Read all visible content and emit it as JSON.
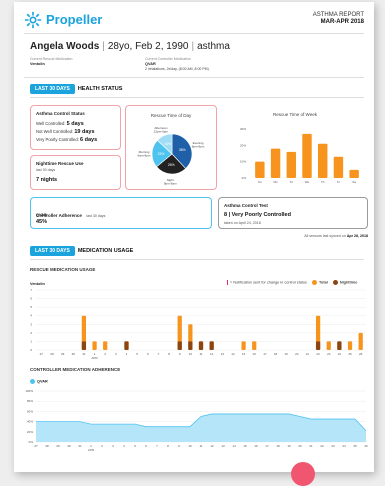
{
  "brand": {
    "name": "Propeller",
    "report_title": "ASTHMA REPORT",
    "report_period": "MAR-APR 2018"
  },
  "patient": {
    "name": "Angela  Woods",
    "age_dob": "28yo, Feb 2, 1990",
    "condition": "asthma"
  },
  "meds": {
    "rescue_label": "Current Rescue Medication",
    "rescue_value": "Ventolin",
    "controller_label": "Current Controller Medication",
    "controller_value": "QVAR",
    "controller_dose": "2 inhalations, 2x/day, (8:00 AM, 8:00 PM)"
  },
  "health": {
    "tab": "LAST 30 DAYS",
    "title": "HEALTH STATUS",
    "status_title": "Asthma Control Status",
    "well_label": "Well Controlled:",
    "well_value": "5 days",
    "notwell_label": "Not Well Controlled:",
    "notwell_value": "19 days",
    "poor_label": "Very Poorly Controlled:",
    "poor_value": "6 days",
    "night_title": "Nighttime Rescue Use",
    "night_sub": "last 30 days",
    "night_value": "7 nights",
    "adh_title": "Controller Adherence",
    "adh_sub": "last 30 days",
    "adh_med": "QVAR",
    "adh_value": "45%",
    "act_title": "Asthma Control Test",
    "act_value": "8 | Very Poorly Controlled",
    "act_sub": "taken on April 24, 2018",
    "synced_prefix": "All sensors last synced on",
    "synced_date": "Apr 28, 2018"
  },
  "rescue_time_day": {
    "title": "Rescue Time of Day",
    "slices": [
      {
        "label": "Evening 6pm-9pm",
        "value": 38,
        "color": "#1f5fa8"
      },
      {
        "label": "Night 9pm-6am",
        "value": 26,
        "color": "#222222"
      },
      {
        "label": "Morning 6am-9pm",
        "value": 23,
        "color": "#4fc3f0"
      },
      {
        "label": "Afternoon 12pm-6pm",
        "value": 13,
        "color": "#9fdcf5"
      }
    ],
    "slice_labels": [
      "38%",
      "26%",
      "23%",
      "13%"
    ]
  },
  "rescue_time_week": {
    "title": "Rescue Time of Week",
    "y_ticks": [
      "30%",
      "20%",
      "10%",
      "0%"
    ],
    "days": [
      "Su",
      "Mo",
      "Tu",
      "We",
      "Th",
      "Fr",
      "Sa"
    ],
    "values": [
      10,
      18,
      16,
      27,
      21,
      13,
      5
    ]
  },
  "medication": {
    "tab": "LAST 30 DAYS",
    "title": "MEDICATION USAGE",
    "rescue_title": "RESCUE MEDICATION USAGE",
    "rescue_med": "Ventolin",
    "notif_text": "= Notification sent for change in control status",
    "legend_total": "Total",
    "legend_night": "Nighttime",
    "controller_title": "CONTROLLER MEDICATION ADHERENCE",
    "controller_med": "QVAR",
    "month_label": "APR"
  },
  "chart_data": [
    {
      "type": "bar",
      "title": "RESCUE MEDICATION USAGE",
      "categories": [
        "27",
        "28",
        "29",
        "30",
        "31",
        "1",
        "2",
        "3",
        "4",
        "5",
        "6",
        "7",
        "8",
        "9",
        "10",
        "11",
        "12",
        "13",
        "14",
        "15",
        "16",
        "17",
        "18",
        "19",
        "20",
        "21",
        "22",
        "23",
        "24",
        "25",
        "26"
      ],
      "y_ticks": [
        "7",
        "6",
        "5",
        "4",
        "3",
        "2",
        "1",
        "0"
      ],
      "ylim": [
        0,
        7
      ],
      "series": [
        {
          "name": "Total",
          "color": "#f7941d",
          "values": [
            0,
            0,
            0,
            0,
            4,
            1,
            1,
            0,
            1,
            0,
            0,
            0,
            0,
            4,
            3,
            1,
            1,
            0,
            0,
            1,
            1,
            0,
            0,
            0,
            0,
            0,
            4,
            1,
            1,
            1,
            2
          ]
        },
        {
          "name": "Nighttime",
          "color": "#8b4513",
          "values": [
            0,
            0,
            0,
            0,
            1,
            0,
            0,
            0,
            1,
            0,
            0,
            0,
            0,
            1,
            1,
            1,
            1,
            0,
            0,
            0,
            0,
            0,
            0,
            0,
            0,
            0,
            1,
            0,
            1,
            0,
            0
          ]
        }
      ]
    },
    {
      "type": "area",
      "title": "CONTROLLER MEDICATION ADHERENCE",
      "categories": [
        "27",
        "28",
        "29",
        "30",
        "31",
        "1",
        "2",
        "3",
        "4",
        "5",
        "6",
        "7",
        "8",
        "9",
        "10",
        "11",
        "12",
        "13",
        "14",
        "15",
        "16",
        "17",
        "18",
        "19",
        "20",
        "21",
        "22",
        "23",
        "24",
        "25",
        "26"
      ],
      "y_ticks": [
        "100%",
        "80%",
        "60%",
        "40%",
        "20%",
        "0%"
      ],
      "ylim": [
        0,
        100
      ],
      "series": [
        {
          "name": "QVAR",
          "color": "#4fc3f0",
          "values": [
            40,
            40,
            40,
            40,
            40,
            35,
            35,
            35,
            35,
            35,
            30,
            30,
            30,
            30,
            30,
            50,
            55,
            55,
            55,
            55,
            55,
            55,
            55,
            55,
            50,
            45,
            45,
            45,
            45,
            45,
            22
          ]
        }
      ]
    }
  ]
}
